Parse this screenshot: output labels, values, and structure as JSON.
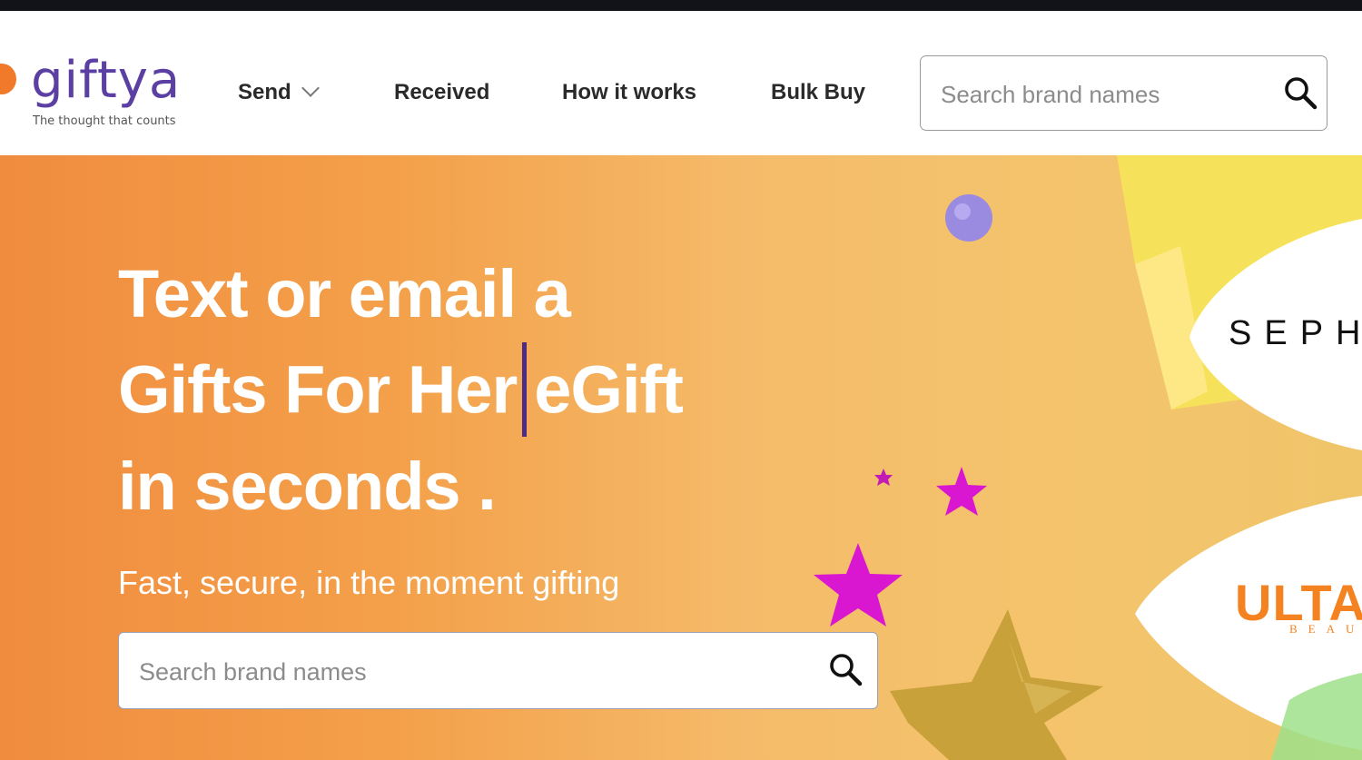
{
  "logo": {
    "wordmark": "giftya",
    "tagline": "The thought that counts"
  },
  "nav": {
    "send": "Send",
    "received": "Received",
    "how_it_works": "How it works",
    "bulk_buy": "Bulk Buy"
  },
  "header_search": {
    "placeholder": "Search brand names"
  },
  "hero": {
    "line1": "Text or email a",
    "line2_typed": "Gifts For Her",
    "line2_rest": "eGift",
    "line3": "in seconds .",
    "subtitle": "Fast, secure, in the moment gifting",
    "search_placeholder": "Search brand names"
  },
  "brands": {
    "sephora": "SEPHO",
    "ulta": "ULTA",
    "ulta_sub": "BEAU"
  },
  "colors": {
    "brand_purple": "#5b3fa3",
    "brand_orange": "#f07a2a",
    "hero_gradient_start": "#f08c3e",
    "hero_gradient_end": "#f0c56a",
    "star_magenta": "#d916d0",
    "star_gold": "#c8a13a"
  },
  "icons": {
    "search": "search-icon",
    "chevron": "chevron-down-icon"
  }
}
